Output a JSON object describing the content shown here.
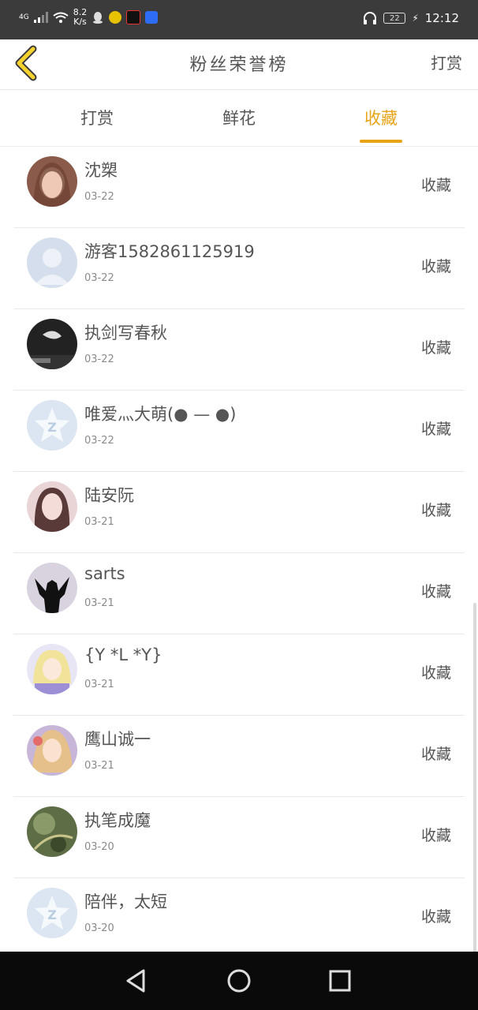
{
  "status_bar": {
    "network": "4G",
    "speed_value": "8.2",
    "speed_unit": "K/s",
    "battery": "22",
    "time": "12:12"
  },
  "header": {
    "title": "粉丝荣誉榜",
    "right_link": "打赏"
  },
  "tabs": [
    {
      "label": "打赏",
      "active": false
    },
    {
      "label": "鲜花",
      "active": false
    },
    {
      "label": "收藏",
      "active": true
    }
  ],
  "accent_color": "#e8a317",
  "list": [
    {
      "name": "沈槊",
      "date": "03-22",
      "action": "收藏",
      "avatar": "photo-girl-1"
    },
    {
      "name": "游客1582861125919",
      "date": "03-22",
      "action": "收藏",
      "avatar": "default-person"
    },
    {
      "name": "执剑写春秋",
      "date": "03-22",
      "action": "收藏",
      "avatar": "dark-photo"
    },
    {
      "name": "唯爱灬大萌(● — ●)",
      "date": "03-22",
      "action": "收藏",
      "avatar": "default-star"
    },
    {
      "name": "陆安阮",
      "date": "03-21",
      "action": "收藏",
      "avatar": "photo-girl-2"
    },
    {
      "name": "sarts",
      "date": "03-21",
      "action": "收藏",
      "avatar": "silhouette"
    },
    {
      "name": "{Y *L *Y}",
      "date": "03-21",
      "action": "收藏",
      "avatar": "anime-1"
    },
    {
      "name": "鹰山诚一",
      "date": "03-21",
      "action": "收藏",
      "avatar": "anime-2"
    },
    {
      "name": "执笔成魔",
      "date": "03-20",
      "action": "收藏",
      "avatar": "green-photo"
    },
    {
      "name": "陪伴，太短",
      "date": "03-20",
      "action": "收藏",
      "avatar": "default-star"
    }
  ]
}
